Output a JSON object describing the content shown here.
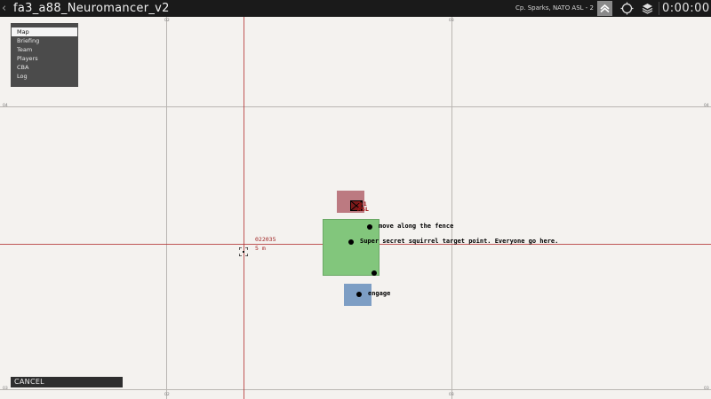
{
  "topbar": {
    "title": "fa3_a88_Neuromancer_v2",
    "player_info": "Cp. Sparks, NATO ASL - 2",
    "clock": "0:00:00",
    "icons": {
      "back": "chevron-left-icon",
      "rank": "rank-chevron-icon",
      "gps": "gps-icon",
      "layers": "layers-icon"
    }
  },
  "menu": {
    "items": [
      "Map",
      "Briefing",
      "Team",
      "Players",
      "CBA",
      "Log"
    ],
    "selected": "Map"
  },
  "map": {
    "grid_labels": {
      "top_left": "02",
      "top_right": "03",
      "bottom_left": "02",
      "bottom_right": "03",
      "left_upper": "04",
      "left_lower": "03",
      "right_upper": "04",
      "right_lower": "03"
    },
    "cursor": {
      "grid": "022035",
      "distance": "5 m"
    },
    "unit": {
      "label_line1": "2-1",
      "label_line2": "ASL"
    },
    "markers": [
      {
        "text": "move along the fence"
      },
      {
        "text": "Super secret squirrel target point. Everyone go here."
      },
      {
        "text": ""
      },
      {
        "text": "engage"
      }
    ],
    "colors": {
      "enemy_zone": "#b8737a",
      "objective_zone": "#82c67c",
      "friendly_zone": "#7d9ec4",
      "crosshair": "#b53a3a"
    }
  },
  "footer": {
    "cancel_label": "CANCEL"
  }
}
